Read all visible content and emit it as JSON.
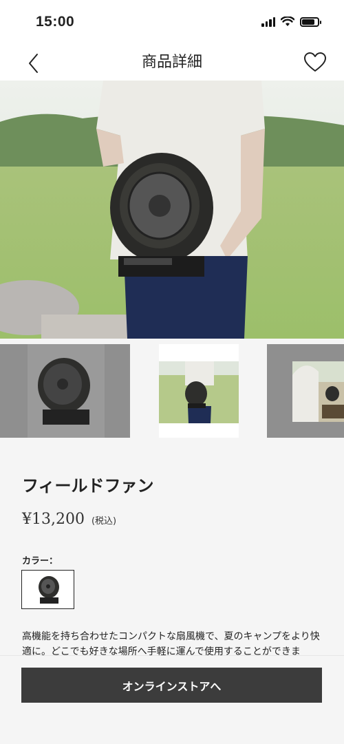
{
  "status_bar": {
    "time": "15:00"
  },
  "nav": {
    "title": "商品詳細",
    "back_icon": "chevron-left-icon",
    "favorite_icon": "heart-icon"
  },
  "hero_image": {
    "description_icon": "product-photo"
  },
  "thumbnails": [
    {
      "name": "fan-product-thumbnail"
    },
    {
      "name": "person-holding-fan-thumbnail"
    },
    {
      "name": "camp-scene-thumbnail"
    }
  ],
  "product": {
    "name": "フィールドファン",
    "price": "¥13,200",
    "tax_label": "(税込)",
    "color_label": "カラー：",
    "description": "高機能を持ち合わせたコンパクトな扇風機で、夏のキャンプをより快適に。どこでも好きな場所へ手軽に運んで使用することができま"
  },
  "actions": {
    "store_button_label": "オンラインストアへ"
  },
  "colors": {
    "accent_button": "#3c3c3c",
    "background": "#f5f5f5"
  }
}
